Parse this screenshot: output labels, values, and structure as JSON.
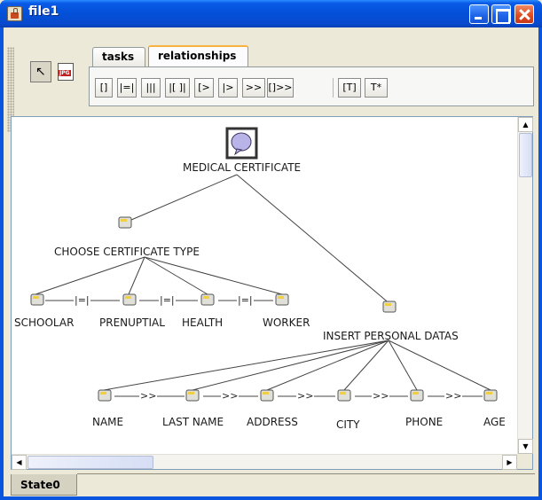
{
  "window": {
    "title": "file1"
  },
  "toolbar": {
    "tabs": [
      {
        "label": "tasks",
        "selected": false
      },
      {
        "label": "relationships",
        "selected": true
      }
    ],
    "operators": [
      "[]",
      "|=|",
      "|||",
      "|[ ]|",
      "[>",
      "|>",
      ">>",
      "[]>>",
      "[T]",
      "T*"
    ]
  },
  "tree": {
    "root": "MEDICAL CERTIFICATE",
    "choose": "CHOOSE CERTIFICATE TYPE",
    "insert": "INSERT PERSONAL DATAS",
    "choices": [
      "SCHOOLAR",
      "PRENUPTIAL",
      "HEALTH",
      "WORKER"
    ],
    "choice_operator": "|=|",
    "fields": [
      "NAME",
      "LAST NAME",
      "ADDRESS",
      "CITY",
      "PHONE",
      "AGE"
    ],
    "field_operator": ">>"
  },
  "status": {
    "state_tab": "State0"
  },
  "colors": {
    "titlebar": "#0350d8",
    "tab_highlight": "#f8b33c",
    "canvas_bg": "#ffffff",
    "root_icon": "#b9b4e8"
  }
}
